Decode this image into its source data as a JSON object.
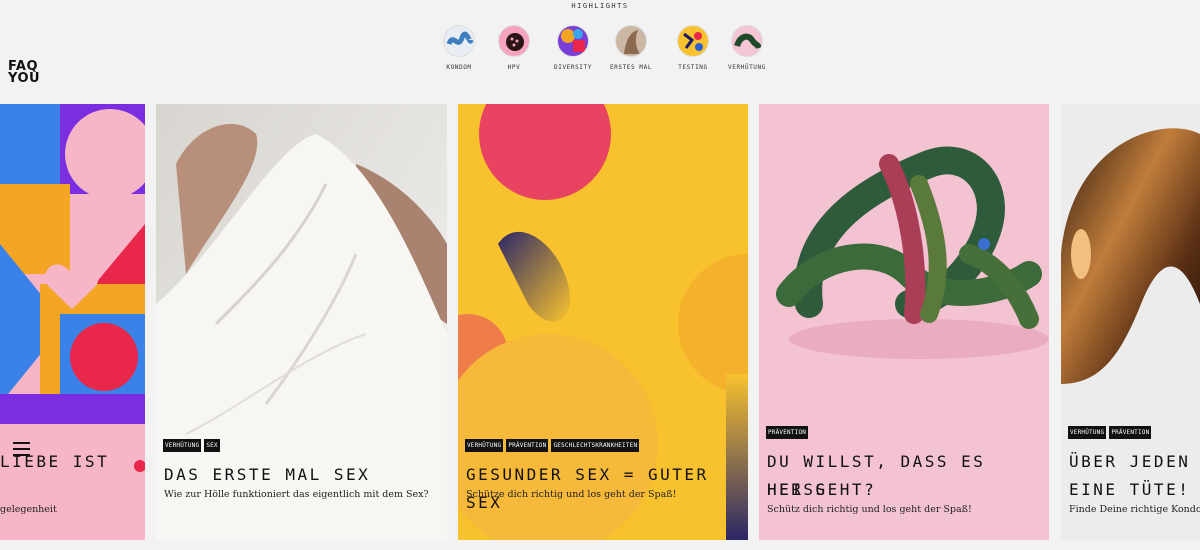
{
  "brand": {
    "logo_line1": "FAQ",
    "logo_line2": "YOU"
  },
  "highlights": {
    "title": "HIGHLIGHTS",
    "items": [
      {
        "label": "KONDOM"
      },
      {
        "label": "HPV"
      },
      {
        "label": "DIVERSITY"
      },
      {
        "label": "ERSTES MAL"
      },
      {
        "label": "TESTING"
      },
      {
        "label": "VERHÜTUNG"
      }
    ]
  },
  "cards": [
    {
      "tags": [],
      "title": "LIEBE IST",
      "subtitle": "gelegenheit"
    },
    {
      "tags": [
        "VERHÜTUNG",
        "SEX"
      ],
      "title": "DAS ERSTE MAL SEX",
      "subtitle": "Wie zur Hölle funktioniert das eigentlich mit dem Sex?"
    },
    {
      "tags": [
        "VERHÜTUNG",
        "PRÄVENTION",
        "GESCHLECHTSKRANKHEITEN"
      ],
      "title": "GESUNDER SEX = GUTER SEX",
      "subtitle": "Schütze dich richtig und los geht der Spaß!"
    },
    {
      "tags": [
        "PRÄVENTION"
      ],
      "title_line1": "DU WILLST, DASS ES HEISS",
      "title_line2": "HER GEHT?",
      "subtitle": "Schütz dich richtig und los geht der Spaß!"
    },
    {
      "tags": [
        "VERHÜTUNG",
        "PRÄVENTION"
      ],
      "title_line1": "ÜBER JEDEN L",
      "title_line2": "EINE TÜTE!",
      "subtitle": "Finde Deine richtige Kondom"
    }
  ]
}
